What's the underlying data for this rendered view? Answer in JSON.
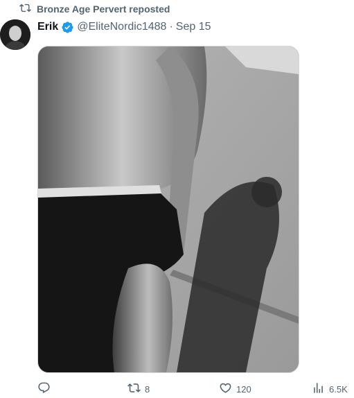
{
  "repost": {
    "label": "Bronze Age Pervert reposted",
    "icon": "repost-icon"
  },
  "tweet": {
    "author_name": "Erik",
    "verified": true,
    "handle": "@EliteNordic1488",
    "separator": "·",
    "date": "Sep 15",
    "media": {
      "kind": "photo",
      "style": "black-and-white"
    }
  },
  "actions": {
    "reply": {
      "icon": "reply-icon",
      "count": ""
    },
    "repost": {
      "icon": "repost-icon",
      "count": "8"
    },
    "like": {
      "icon": "heart-icon",
      "count": "120"
    },
    "views": {
      "icon": "views-icon",
      "count": "6.5K"
    }
  },
  "colors": {
    "text_primary": "#0f1419",
    "text_secondary": "#536471",
    "verified_blue": "#1d9bf0",
    "border": "#cfd9de"
  }
}
